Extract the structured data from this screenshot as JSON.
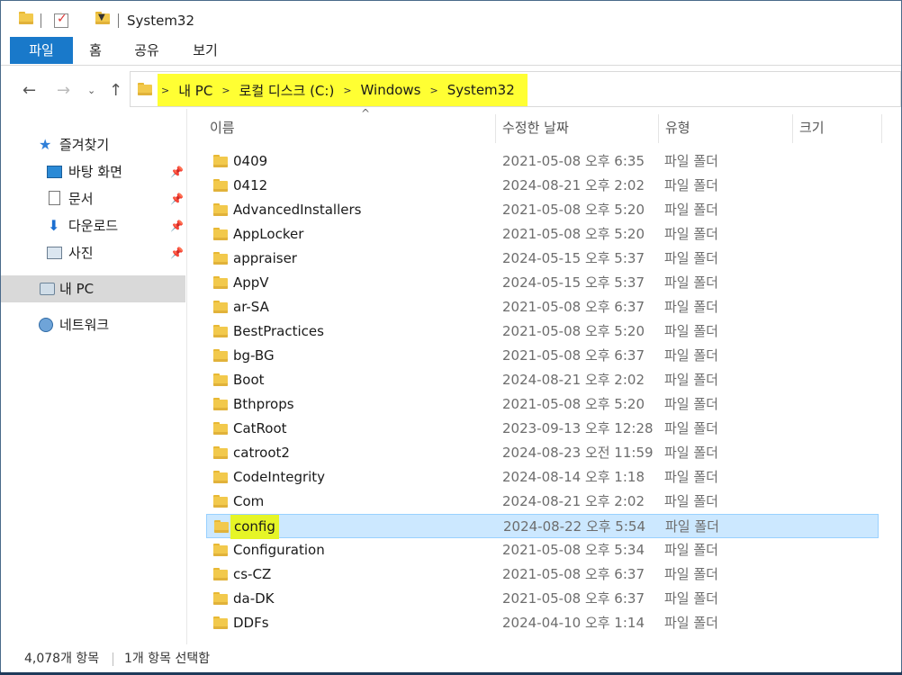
{
  "window": {
    "title": "System32"
  },
  "ribbon": {
    "tabs": [
      "파일",
      "홈",
      "공유",
      "보기"
    ]
  },
  "address": {
    "crumbs": [
      "내 PC",
      "로컬 디스크 (C:)",
      "Windows",
      "System32"
    ],
    "highlight_color": "#ffff33"
  },
  "sidebar": {
    "favorites": "즐겨찾기",
    "items": [
      "바탕 화면",
      "문서",
      "다운로드",
      "사진"
    ],
    "this_pc": "내 PC",
    "network": "네트워크"
  },
  "columns": {
    "name": "이름",
    "date": "수정한 날짜",
    "type": "유형",
    "size": "크기"
  },
  "files": [
    {
      "name": "0409",
      "date": "2021-05-08 오후 6:35",
      "type": "파일 폴더"
    },
    {
      "name": "0412",
      "date": "2024-08-21 오후 2:02",
      "type": "파일 폴더"
    },
    {
      "name": "AdvancedInstallers",
      "date": "2021-05-08 오후 5:20",
      "type": "파일 폴더"
    },
    {
      "name": "AppLocker",
      "date": "2021-05-08 오후 5:20",
      "type": "파일 폴더"
    },
    {
      "name": "appraiser",
      "date": "2024-05-15 오후 5:37",
      "type": "파일 폴더"
    },
    {
      "name": "AppV",
      "date": "2024-05-15 오후 5:37",
      "type": "파일 폴더"
    },
    {
      "name": "ar-SA",
      "date": "2021-05-08 오후 6:37",
      "type": "파일 폴더"
    },
    {
      "name": "BestPractices",
      "date": "2021-05-08 오후 5:20",
      "type": "파일 폴더"
    },
    {
      "name": "bg-BG",
      "date": "2021-05-08 오후 6:37",
      "type": "파일 폴더"
    },
    {
      "name": "Boot",
      "date": "2024-08-21 오후 2:02",
      "type": "파일 폴더"
    },
    {
      "name": "Bthprops",
      "date": "2021-05-08 오후 5:20",
      "type": "파일 폴더"
    },
    {
      "name": "CatRoot",
      "date": "2023-09-13 오후 12:28",
      "type": "파일 폴더"
    },
    {
      "name": "catroot2",
      "date": "2024-08-23 오전 11:59",
      "type": "파일 폴더"
    },
    {
      "name": "CodeIntegrity",
      "date": "2024-08-14 오후 1:18",
      "type": "파일 폴더"
    },
    {
      "name": "Com",
      "date": "2024-08-21 오후 2:02",
      "type": "파일 폴더"
    },
    {
      "name": "config",
      "date": "2024-08-22 오후 5:54",
      "type": "파일 폴더",
      "selected": true
    },
    {
      "name": "Configuration",
      "date": "2021-05-08 오후 5:34",
      "type": "파일 폴더"
    },
    {
      "name": "cs-CZ",
      "date": "2021-05-08 오후 6:37",
      "type": "파일 폴더"
    },
    {
      "name": "da-DK",
      "date": "2021-05-08 오후 6:37",
      "type": "파일 폴더"
    },
    {
      "name": "DDFs",
      "date": "2024-04-10 오후 1:14",
      "type": "파일 폴더"
    }
  ],
  "status": {
    "count": "4,078개 항목",
    "selected": "1개 항목 선택함"
  }
}
